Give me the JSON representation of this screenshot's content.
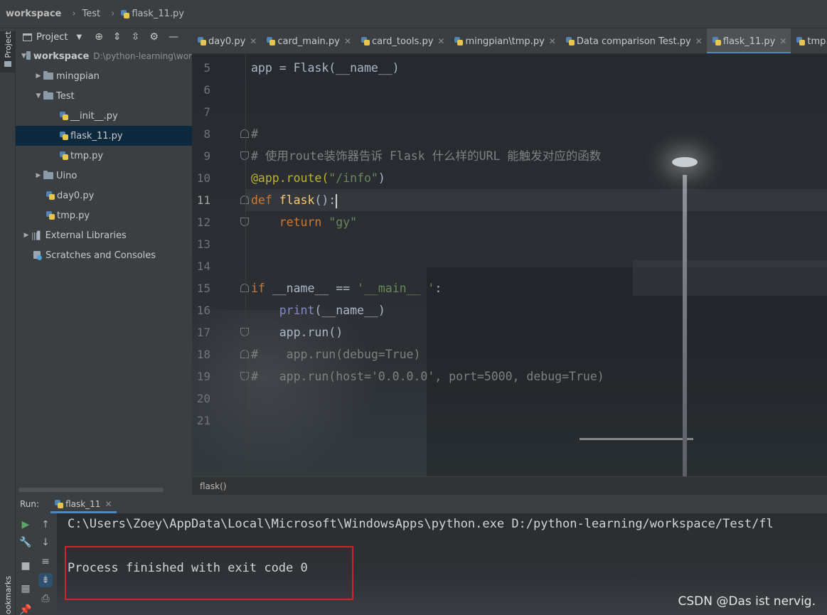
{
  "navbar": {
    "crumbs": [
      "workspace",
      "Test",
      "flask_11.py"
    ]
  },
  "left_stripe": {
    "project_label": "Project",
    "bookmarks_label": "Bookmarks"
  },
  "project_panel": {
    "title": "Project",
    "tree": [
      {
        "label": "workspace",
        "path": "D:\\python-learning\\wor",
        "type": "root",
        "expanded": true
      },
      {
        "label": "mingpian",
        "type": "folder",
        "expanded": false
      },
      {
        "label": "Test",
        "type": "folder",
        "expanded": true
      },
      {
        "label": "__init__.py",
        "type": "file"
      },
      {
        "label": "flask_11.py",
        "type": "file",
        "selected": true
      },
      {
        "label": "tmp.py",
        "type": "file"
      },
      {
        "label": "Uino",
        "type": "folder",
        "expanded": false
      },
      {
        "label": "day0.py",
        "type": "file"
      },
      {
        "label": "tmp.py",
        "type": "file"
      },
      {
        "label": "External Libraries",
        "type": "library",
        "expanded": false
      },
      {
        "label": "Scratches and Consoles",
        "type": "scratch"
      }
    ]
  },
  "tabs": [
    {
      "label": "day0.py"
    },
    {
      "label": "card_main.py"
    },
    {
      "label": "card_tools.py"
    },
    {
      "label": "mingpian\\tmp.py"
    },
    {
      "label": "Data comparison Test.py"
    },
    {
      "label": "flask_11.py",
      "active": true
    },
    {
      "label": "tmp.py"
    }
  ],
  "editor": {
    "current_line": 11,
    "line_numbers": [
      "5",
      "6",
      "7",
      "8",
      "9",
      "10",
      "11",
      "12",
      "13",
      "14",
      "15",
      "16",
      "17",
      "18",
      "19",
      "20",
      "21"
    ],
    "code": {
      "l5": "app = Flask(__name__)",
      "l8": "#",
      "l9": "# 使用route装饰器告诉 Flask 什么样的URL 能触发对应的函数",
      "l10_dec": "@app.route(",
      "l10_str": "\"/info\"",
      "l10_end": ")",
      "l11_kw": "def ",
      "l11_fn": "flask",
      "l11_end": "():",
      "l12_kw": "    return ",
      "l12_str": "\"gy\"",
      "l15_kw": "if ",
      "l15_mid": "__name__ == ",
      "l15_str": "'__main__ '",
      "l15_end": ":",
      "l16_pre": "    ",
      "l16_fn": "print",
      "l16_end": "(__name__)",
      "l17": "    app.run()",
      "l18": "#    app.run(debug=True)",
      "l19": "#   app.run(host='0.0.0.0', port=5000, debug=True)"
    },
    "breadcrumb": "flask()"
  },
  "run_panel": {
    "label": "Run:",
    "tab": "flask_11",
    "console": {
      "command": "C:\\Users\\Zoey\\AppData\\Local\\Microsoft\\WindowsApps\\python.exe D:/python-learning/workspace/Test/fl",
      "exit_message": "Process finished with exit code 0"
    }
  },
  "watermark": "CSDN @Das ist nervig.",
  "colors": {
    "keyword": "#cc7832",
    "function": "#ffc66d",
    "string": "#6a8759",
    "comment": "#808080",
    "decorator": "#bbb529",
    "accent": "#4a88c7",
    "highlight_box": "#d2232a"
  }
}
